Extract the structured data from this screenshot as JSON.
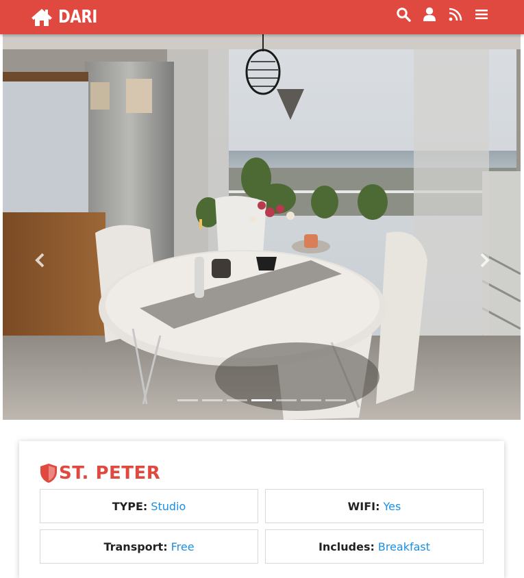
{
  "brand": {
    "name": "DARI",
    "icon": "home-icon"
  },
  "nav": {
    "icons": [
      "search-icon",
      "user-icon",
      "rss-icon",
      "menu-icon"
    ]
  },
  "carousel": {
    "slide_count": 7,
    "active_index": 3,
    "prev_icon": "chevron-left-icon",
    "next_icon": "chevron-right-icon"
  },
  "property": {
    "title": "ST. PETER",
    "title_icon": "shield-icon",
    "details": [
      {
        "label": "TYPE:",
        "value": "Studio"
      },
      {
        "label": "WIFI:",
        "value": "Yes"
      },
      {
        "label": "Transport:",
        "value": "Free"
      },
      {
        "label": "Includes:",
        "value": "Breakfast"
      }
    ]
  },
  "colors": {
    "accent": "#e0493f",
    "link": "#1a8fe3"
  }
}
